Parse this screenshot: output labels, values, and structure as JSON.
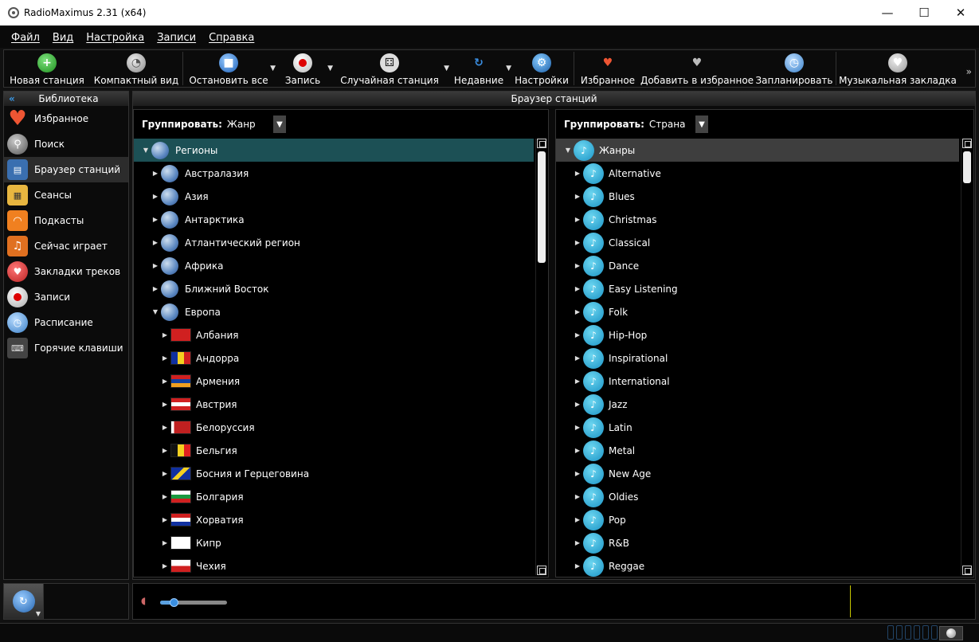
{
  "window": {
    "title": "RadioMaximus 2.31 (x64)",
    "minimize": "—",
    "maximize": "☐",
    "close": "✕"
  },
  "menu": [
    "Файл",
    "Вид",
    "Настройка",
    "Записи",
    "Справка"
  ],
  "toolbar": {
    "new_station": "Новая станция",
    "compact_view": "Компактный вид",
    "stop_all": "Остановить все",
    "record": "Запись",
    "random_station": "Случайная станция",
    "recent": "Недавние",
    "settings": "Настройки",
    "favorites": "Избранное",
    "add_favorites": "Добавить в избранное",
    "schedule": "Запланировать",
    "music_bookmark": "Музыкальная закладка",
    "more": "»"
  },
  "library": {
    "title": "Библиотека",
    "items": [
      {
        "label": "Избранное",
        "icon": "heart-icon",
        "active": false
      },
      {
        "label": "Поиск",
        "icon": "search-icon",
        "active": false
      },
      {
        "label": "Браузер станций",
        "icon": "browser-icon",
        "active": true
      },
      {
        "label": "Сеансы",
        "icon": "schedule-icon",
        "active": false
      },
      {
        "label": "Подкасты",
        "icon": "podcast-icon",
        "active": false
      },
      {
        "label": "Сейчас играет",
        "icon": "now-playing-icon",
        "active": false
      },
      {
        "label": "Закладки треков",
        "icon": "bookmark-icon",
        "active": false
      },
      {
        "label": "Записи",
        "icon": "record-icon",
        "active": false
      },
      {
        "label": "Расписание",
        "icon": "clock-icon",
        "active": false
      },
      {
        "label": "Горячие клавиши",
        "icon": "keyboard-icon",
        "active": false
      }
    ]
  },
  "browser": {
    "title": "Браузер станций",
    "left": {
      "group_label": "Группировать:",
      "group_value": "Жанр",
      "items": [
        {
          "label": "Регионы",
          "level": 0,
          "expanded": true,
          "icon": "globe",
          "selected": true
        },
        {
          "label": "Австралазия",
          "level": 1,
          "expanded": false,
          "icon": "globe"
        },
        {
          "label": "Азия",
          "level": 1,
          "expanded": false,
          "icon": "globe"
        },
        {
          "label": "Антарктика",
          "level": 1,
          "expanded": false,
          "icon": "globe"
        },
        {
          "label": "Атлантический регион",
          "level": 1,
          "expanded": false,
          "icon": "globe"
        },
        {
          "label": "Африка",
          "level": 1,
          "expanded": false,
          "icon": "globe"
        },
        {
          "label": "Ближний Восток",
          "level": 1,
          "expanded": false,
          "icon": "globe"
        },
        {
          "label": "Европа",
          "level": 1,
          "expanded": true,
          "icon": "globe"
        },
        {
          "label": "Албания",
          "level": 2,
          "expanded": false,
          "icon": "flag-albania"
        },
        {
          "label": "Андорра",
          "level": 2,
          "expanded": false,
          "icon": "flag-andorra"
        },
        {
          "label": "Армения",
          "level": 2,
          "expanded": false,
          "icon": "flag-armenia"
        },
        {
          "label": "Австрия",
          "level": 2,
          "expanded": false,
          "icon": "flag-austria"
        },
        {
          "label": "Белоруссия",
          "level": 2,
          "expanded": false,
          "icon": "flag-belarus"
        },
        {
          "label": "Бельгия",
          "level": 2,
          "expanded": false,
          "icon": "flag-belgium"
        },
        {
          "label": "Босния и Герцеговина",
          "level": 2,
          "expanded": false,
          "icon": "flag-bosnia"
        },
        {
          "label": "Болгария",
          "level": 2,
          "expanded": false,
          "icon": "flag-bulgaria"
        },
        {
          "label": "Хорватия",
          "level": 2,
          "expanded": false,
          "icon": "flag-croatia"
        },
        {
          "label": "Кипр",
          "level": 2,
          "expanded": false,
          "icon": "flag-cyprus"
        },
        {
          "label": "Чехия",
          "level": 2,
          "expanded": false,
          "icon": "flag-czech"
        }
      ]
    },
    "right": {
      "group_label": "Группировать:",
      "group_value": "Страна",
      "items": [
        {
          "label": "Жанры",
          "level": 0,
          "expanded": true,
          "selected": true
        },
        {
          "label": "Alternative",
          "level": 1,
          "expanded": false
        },
        {
          "label": "Blues",
          "level": 1,
          "expanded": false
        },
        {
          "label": "Christmas",
          "level": 1,
          "expanded": false
        },
        {
          "label": "Classical",
          "level": 1,
          "expanded": false
        },
        {
          "label": "Dance",
          "level": 1,
          "expanded": false
        },
        {
          "label": "Easy Listening",
          "level": 1,
          "expanded": false
        },
        {
          "label": "Folk",
          "level": 1,
          "expanded": false
        },
        {
          "label": "Hip-Hop",
          "level": 1,
          "expanded": false
        },
        {
          "label": "Inspirational",
          "level": 1,
          "expanded": false
        },
        {
          "label": "International",
          "level": 1,
          "expanded": false
        },
        {
          "label": "Jazz",
          "level": 1,
          "expanded": false
        },
        {
          "label": "Latin",
          "level": 1,
          "expanded": false
        },
        {
          "label": "Metal",
          "level": 1,
          "expanded": false
        },
        {
          "label": "New Age",
          "level": 1,
          "expanded": false
        },
        {
          "label": "Oldies",
          "level": 1,
          "expanded": false
        },
        {
          "label": "Pop",
          "level": 1,
          "expanded": false
        },
        {
          "label": "R&B",
          "level": 1,
          "expanded": false
        },
        {
          "label": "Reggae",
          "level": 1,
          "expanded": false
        }
      ]
    }
  },
  "player": {
    "volume": 0.2
  },
  "colors": {
    "accent": "#3a9ae8",
    "selection_left": "#1c5055",
    "selection_right": "#3e3e3e"
  }
}
